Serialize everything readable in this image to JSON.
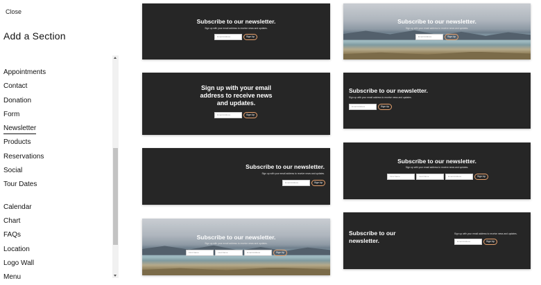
{
  "sidebar": {
    "close_label": "Close",
    "title": "Add a Section",
    "items_group1": [
      "Appointments",
      "Contact",
      "Donation",
      "Form",
      "Newsletter",
      "Products",
      "Reservations",
      "Social",
      "Tour Dates"
    ],
    "items_group2": [
      "Calendar",
      "Chart",
      "FAQs",
      "Location",
      "Logo Wall",
      "Menu"
    ],
    "active_item": "Newsletter"
  },
  "templates": {
    "headline_default": "Subscribe to our newsletter.",
    "headline_signup_line1": "Sign up with your email",
    "headline_signup_line2": "address to receive news",
    "headline_signup_line3": "and updates.",
    "headline_two_line_1": "Subscribe to our",
    "headline_two_line_2": "newsletter.",
    "subtext": "Sign up with your email address to receive news and updates.",
    "email_placeholder": "Email Address",
    "first_name_placeholder": "First Name",
    "last_name_placeholder": "Last Name",
    "button_label": "Sign Up"
  },
  "colors": {
    "card_bg": "#262626",
    "button_border": "#e8a26e"
  }
}
